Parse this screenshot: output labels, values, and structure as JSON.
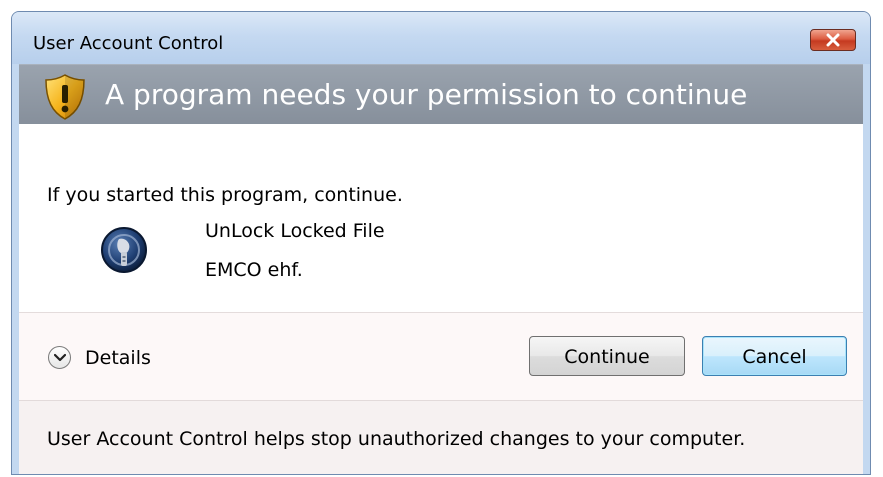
{
  "window": {
    "title": "User Account Control"
  },
  "banner": {
    "heading": "A program needs your permission to continue",
    "icon": "shield-warning-icon"
  },
  "content": {
    "intro": "If you started this program, continue.",
    "program": {
      "name": "UnLock Locked File",
      "publisher": "EMCO ehf.",
      "icon": "program-icon"
    }
  },
  "actions": {
    "details_label": "Details",
    "continue_label": "Continue",
    "cancel_label": "Cancel"
  },
  "footer": {
    "text": "User Account Control helps stop unauthorized changes to your computer."
  },
  "colors": {
    "banner": "#8b949f",
    "cancel_focus": "#3c7fb1",
    "close_button": "#d04a2f"
  }
}
